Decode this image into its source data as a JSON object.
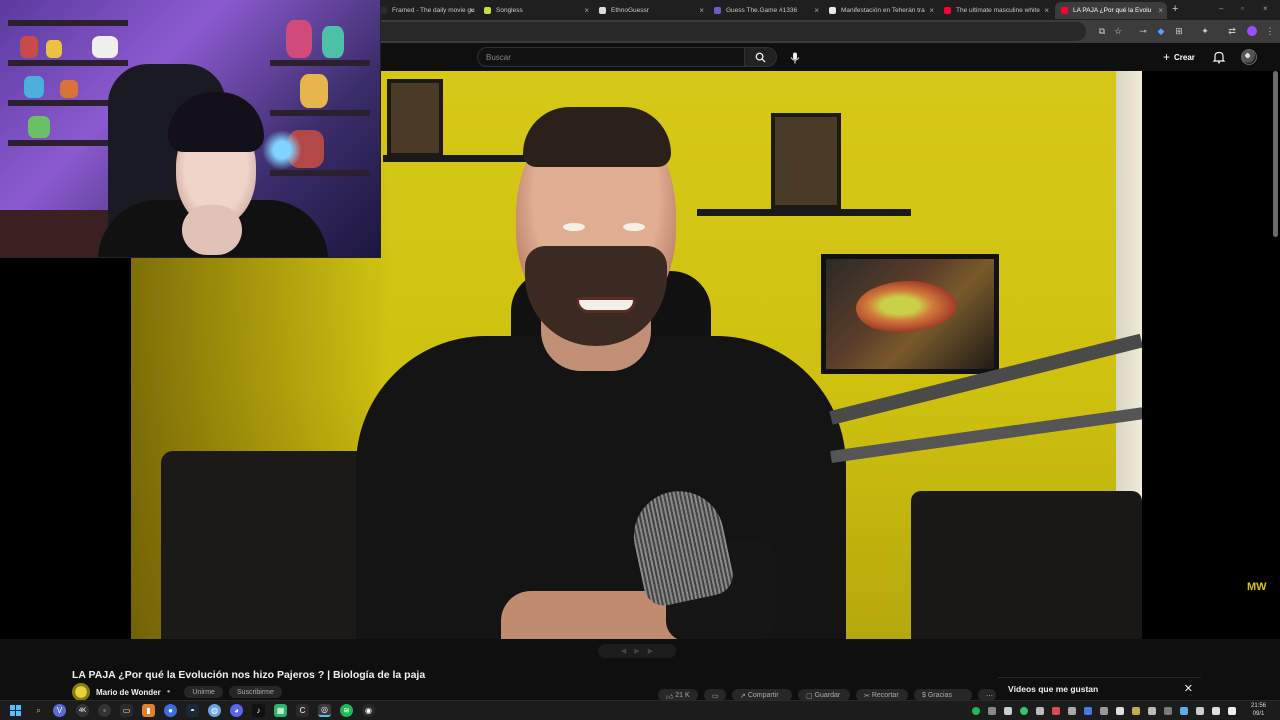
{
  "browser": {
    "tabs": [
      {
        "label": "Framed - The daily movie gu",
        "favicon_color": "#2b2b2b",
        "active": false
      },
      {
        "label": "Songless",
        "favicon_color": "#c3e23a",
        "active": false
      },
      {
        "label": "EthnoGuessr",
        "favicon_color": "#dddddd",
        "active": false
      },
      {
        "label": "Guess The.Game #1336",
        "favicon_color": "#6d5acf",
        "active": false
      },
      {
        "label": "Manifestación en Teherán tra",
        "favicon_color": "#e8e8e8",
        "active": false
      },
      {
        "label": "The ultimate masculine white",
        "favicon_color": "#ff0033",
        "active": false
      },
      {
        "label": "LA PAJA ¿Por qué la Evolu",
        "favicon_color": "#ff0033",
        "active": true
      }
    ],
    "new_tab_icon": "plus-icon"
  },
  "youtube": {
    "search_placeholder": "Buscar",
    "create_label": "Crear",
    "video": {
      "title": "LA PAJA ¿Por qué la Evolución nos hizo Pajeros ? | Biología de la paja",
      "channel": "Mario de Wonder",
      "join_label": "Unirme",
      "subscribe_label": "Suscribirme",
      "likes": "21 K",
      "share_label": "Compartir",
      "save_label": "Guardar",
      "clip_label": "Recortar",
      "thanks_label": "Gracias",
      "watermark": "MW"
    },
    "liked_panel": {
      "title": "Vídeos que me gustan"
    }
  },
  "taskbar": {
    "time": "21:56",
    "date": "09/1"
  },
  "colors": {
    "accent_red": "#ff0033",
    "wall_yellow": "#d4c614",
    "page_bg": "#0f0f0f"
  }
}
